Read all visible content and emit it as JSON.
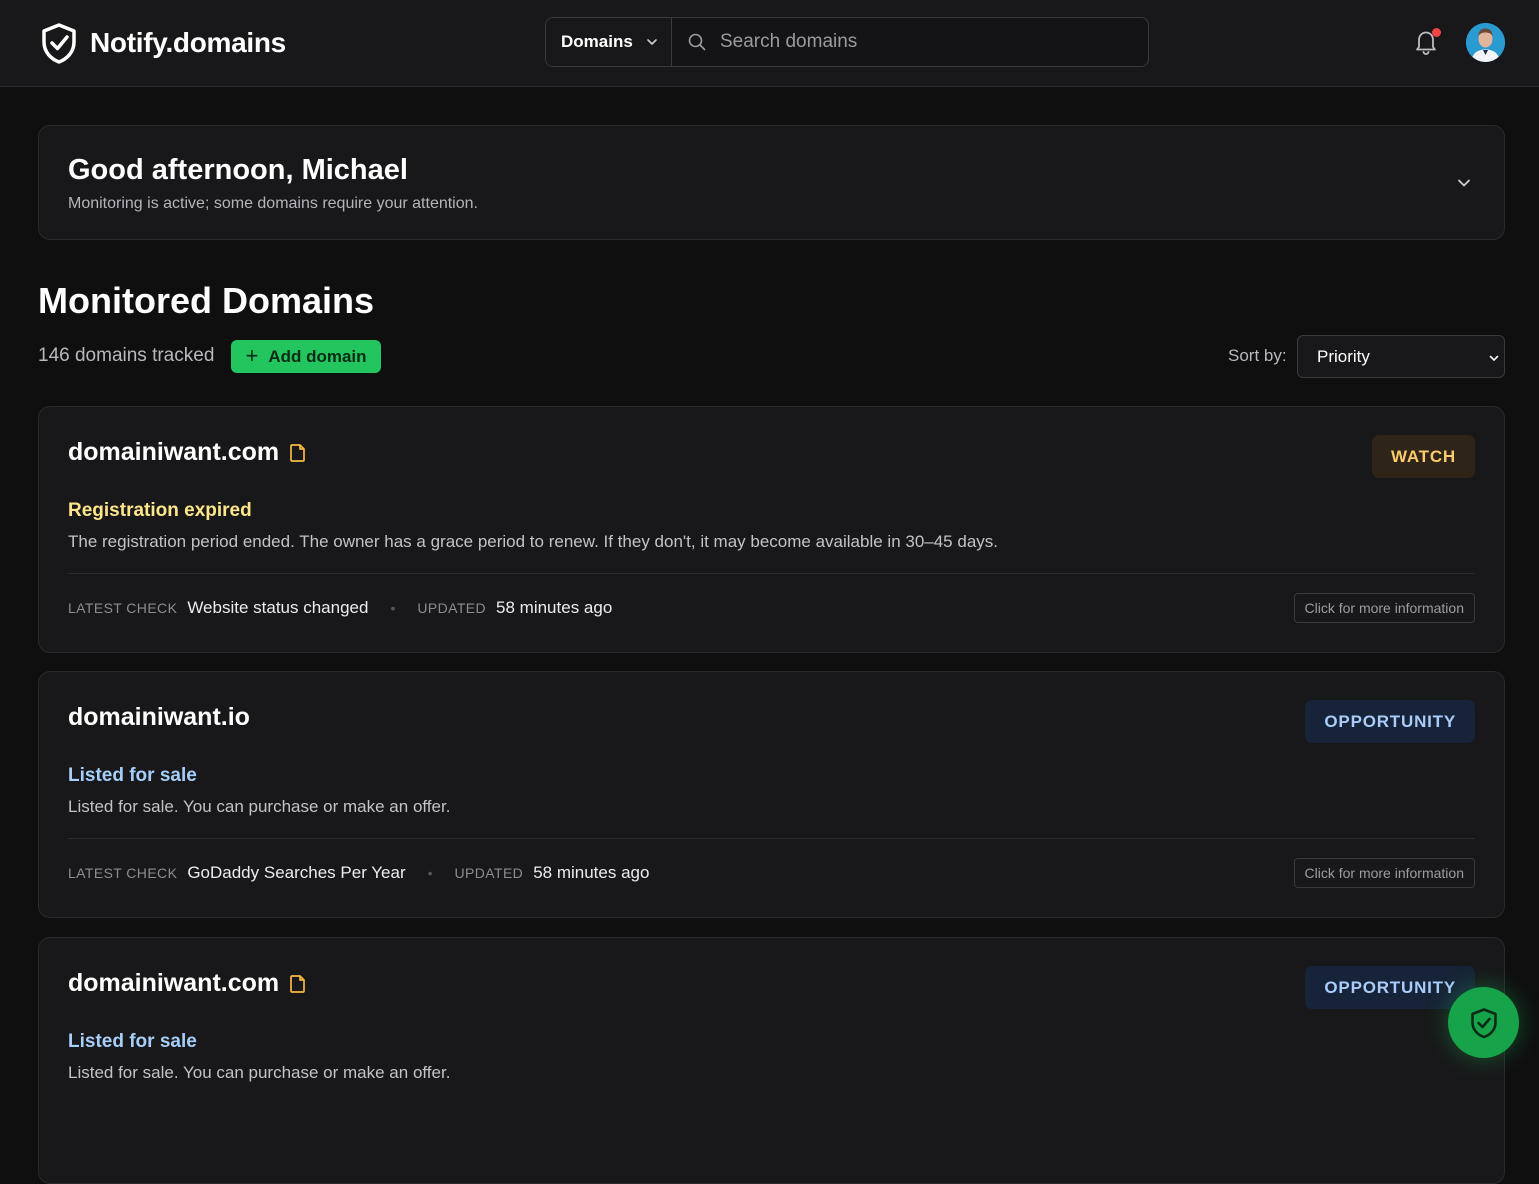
{
  "header": {
    "brand": "Notify.domains",
    "scope_label": "Domains",
    "search_placeholder": "Search domains",
    "has_unread_notifications": true
  },
  "greeting": {
    "title": "Good afternoon, Michael",
    "subtitle": "Monitoring is active; some domains require your attention."
  },
  "section": {
    "title": "Monitored Domains",
    "tracked": "146 domains tracked",
    "add_label": "Add domain",
    "sort_label": "Sort by:",
    "sort_value": "Priority"
  },
  "cards": [
    {
      "domain": "domainiwant.com",
      "has_doc_icon": true,
      "tag": "WATCH",
      "status_title": "Registration expired",
      "status_desc": "The registration period ended. The owner has a grace period to renew. If they don't, it may become available in 30–45 days.",
      "latest_check_key": "LATEST CHECK",
      "latest_check": "Website status changed",
      "updated_key": "UPDATED",
      "updated": "58 minutes ago",
      "info_label": "Click for more information"
    },
    {
      "domain": "domainiwant.io",
      "has_doc_icon": false,
      "tag": "OPPORTUNITY",
      "status_title": "Listed for sale",
      "status_desc": "Listed for sale. You can purchase or make an offer.",
      "latest_check_key": "LATEST CHECK",
      "latest_check": "GoDaddy Searches Per Year",
      "updated_key": "UPDATED",
      "updated": "58 minutes ago",
      "info_label": "Click for more information"
    },
    {
      "domain": "domainiwant.com",
      "has_doc_icon": true,
      "tag": "OPPORTUNITY",
      "status_title": "Listed for sale",
      "status_desc": "Listed for sale. You can purchase or make an offer."
    }
  ],
  "colors": {
    "accent_green": "#22c55e",
    "watch": "#facc6b",
    "opportunity": "#a6cefa",
    "notification_dot": "#ef4444"
  },
  "icons": [
    "shield-check-icon",
    "chevron-down-icon",
    "search-icon",
    "bell-icon",
    "document-icon",
    "plus-icon"
  ]
}
